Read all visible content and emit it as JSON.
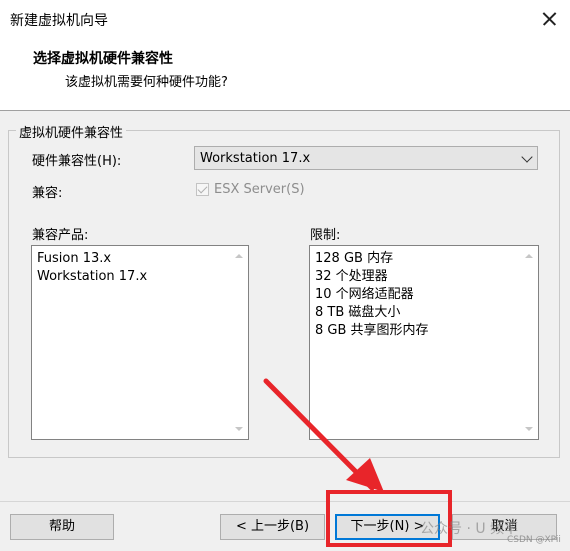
{
  "window": {
    "title": "新建虚拟机向导"
  },
  "header": {
    "title": "选择虚拟机硬件兼容性",
    "subtitle": "该虚拟机需要何种硬件功能?"
  },
  "group": {
    "legend": "虚拟机硬件兼容性",
    "compat_label": "硬件兼容性(H):",
    "compat_value": "Workstation 17.x",
    "compatible_label": "兼容:",
    "esx_checkbox": {
      "label": "ESX Server(S)",
      "checked": true,
      "enabled": false
    },
    "products_label": "兼容产品:",
    "products": [
      "Fusion 13.x",
      "Workstation 17.x"
    ],
    "limits_label": "限制:",
    "limits": [
      "128 GB 内存",
      "32 个处理器",
      "10 个网络适配器",
      "8 TB 磁盘大小",
      "8 GB 共享图形内存"
    ]
  },
  "buttons": {
    "help": "帮助",
    "back": "< 上一步(B)",
    "next": "下一步(N) >",
    "cancel": "取消"
  },
  "overlay": {
    "annotation_color": "#e8252a",
    "watermark": "公众号 · U 频率",
    "csdn": "CSDN @XPii"
  },
  "colors": {
    "accent": "#0078d7"
  }
}
